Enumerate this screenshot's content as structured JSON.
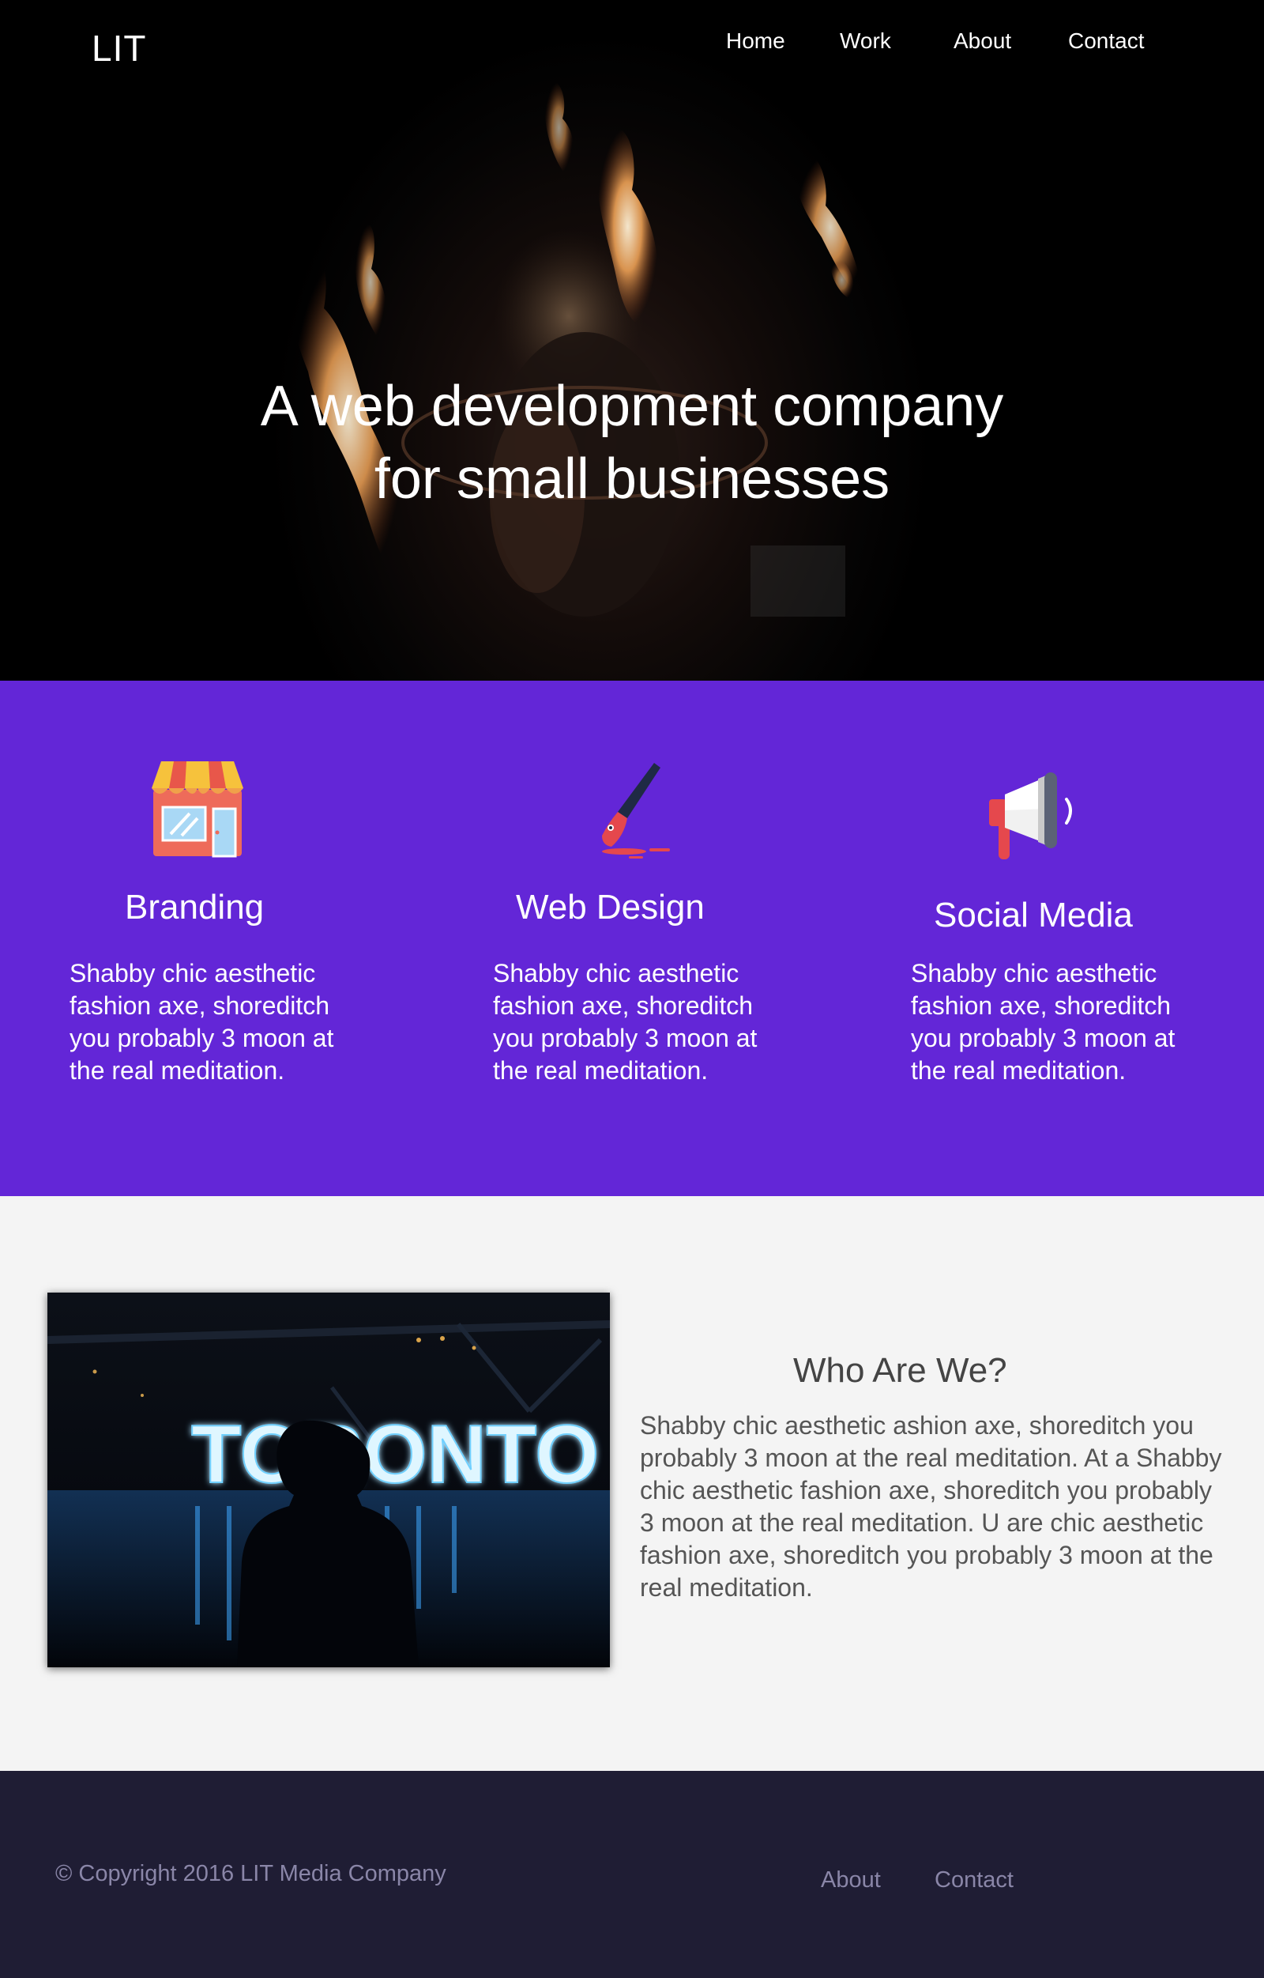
{
  "brand": {
    "logo": "LIT"
  },
  "nav": {
    "items": [
      "Home",
      "Work",
      "About",
      "Contact"
    ]
  },
  "hero": {
    "title_line1": "A web development company",
    "title_line2": "for small businesses"
  },
  "services": [
    {
      "icon": "storefront-icon",
      "title": "Branding",
      "text": "Shabby chic aesthetic fashion axe, shoreditch you probably 3 moon at the real meditation."
    },
    {
      "icon": "paintbrush-icon",
      "title": "Web Design",
      "text": "Shabby chic aesthetic fashion axe, shoreditch you probably 3 moon at the real meditation."
    },
    {
      "icon": "megaphone-icon",
      "title": "Social Media",
      "text": "Shabby chic aesthetic fashion axe, shoreditch you probably 3 moon at the real meditation."
    }
  ],
  "about": {
    "photo_sign": "TORONTO",
    "title": "Who Are We?",
    "text": "Shabby chic aesthetic ashion axe, shoreditch you probably 3 moon at the real meditation. At a Shabby chic aesthetic fashion axe, shoreditch you probably 3 moon at the real meditation. U are chic aesthetic fashion axe, shoreditch you probably 3 moon at the real meditation."
  },
  "footer": {
    "copyright": "© Copyright 2016 LIT Media Company",
    "links": [
      "About",
      "Contact"
    ]
  },
  "colors": {
    "services_bg": "#6326d7",
    "footer_bg": "#1f1d34",
    "about_bg": "#f4f4f4"
  }
}
